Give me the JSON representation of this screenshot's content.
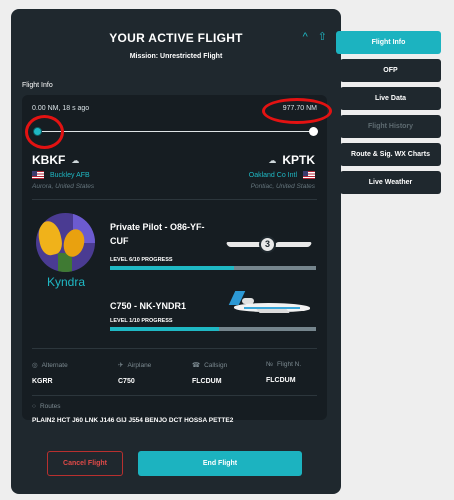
{
  "panel": {
    "title": "YOUR ACTIVE FLIGHT",
    "mission": "Mission: Unrestricted Flight",
    "section_label": "Flight Info"
  },
  "route": {
    "elapsed": "0.00 NM, 18 s ago",
    "total_distance": "977.70 NM",
    "progress": 0.0
  },
  "departure": {
    "icao": "KBKF",
    "name": "Buckley AFB",
    "location": "Aurora, United States"
  },
  "arrival": {
    "icao": "KPTK",
    "name": "Oakland Co Intl",
    "location": "Pontiac, United States"
  },
  "pilot": {
    "username": "Kyndra",
    "rank_title": "Private Pilot - O86-YF-CUF",
    "rank_level": "LEVEL 6/10 PROGRESS",
    "rank_progress": 0.6,
    "wings_badge": "3"
  },
  "aircraft": {
    "title": "C750 - NK-YNDR1",
    "level": "LEVEL 1/10 PROGRESS",
    "progress": 0.53
  },
  "details": {
    "alternate_label": "Alternate",
    "alternate": "KGRR",
    "airplane_label": "Airplane",
    "airplane": "C750",
    "callsign_label": "Callsign",
    "callsign": "FLCDUM",
    "flight_label": "Flight N.",
    "flight": "FLCDUM"
  },
  "routes": {
    "label": "Routes",
    "value": "PLAIN2 HCT J60 LNK J146 GIJ J554 BENJO DCT HOSSA PETTE2"
  },
  "buttons": {
    "cancel": "Cancel Flight",
    "end": "End Flight"
  },
  "nav": [
    {
      "label": "Flight Info",
      "state": "active"
    },
    {
      "label": "OFP",
      "state": "normal"
    },
    {
      "label": "Live Data",
      "state": "normal"
    },
    {
      "label": "Flight History",
      "state": "disabled"
    },
    {
      "label": "Route & Sig. WX Charts",
      "state": "normal"
    },
    {
      "label": "Live Weather",
      "state": "normal"
    }
  ],
  "colors": {
    "accent": "#1cb3c0",
    "panel": "#1f282e",
    "card": "#161d22",
    "annotation": "#e31212"
  }
}
